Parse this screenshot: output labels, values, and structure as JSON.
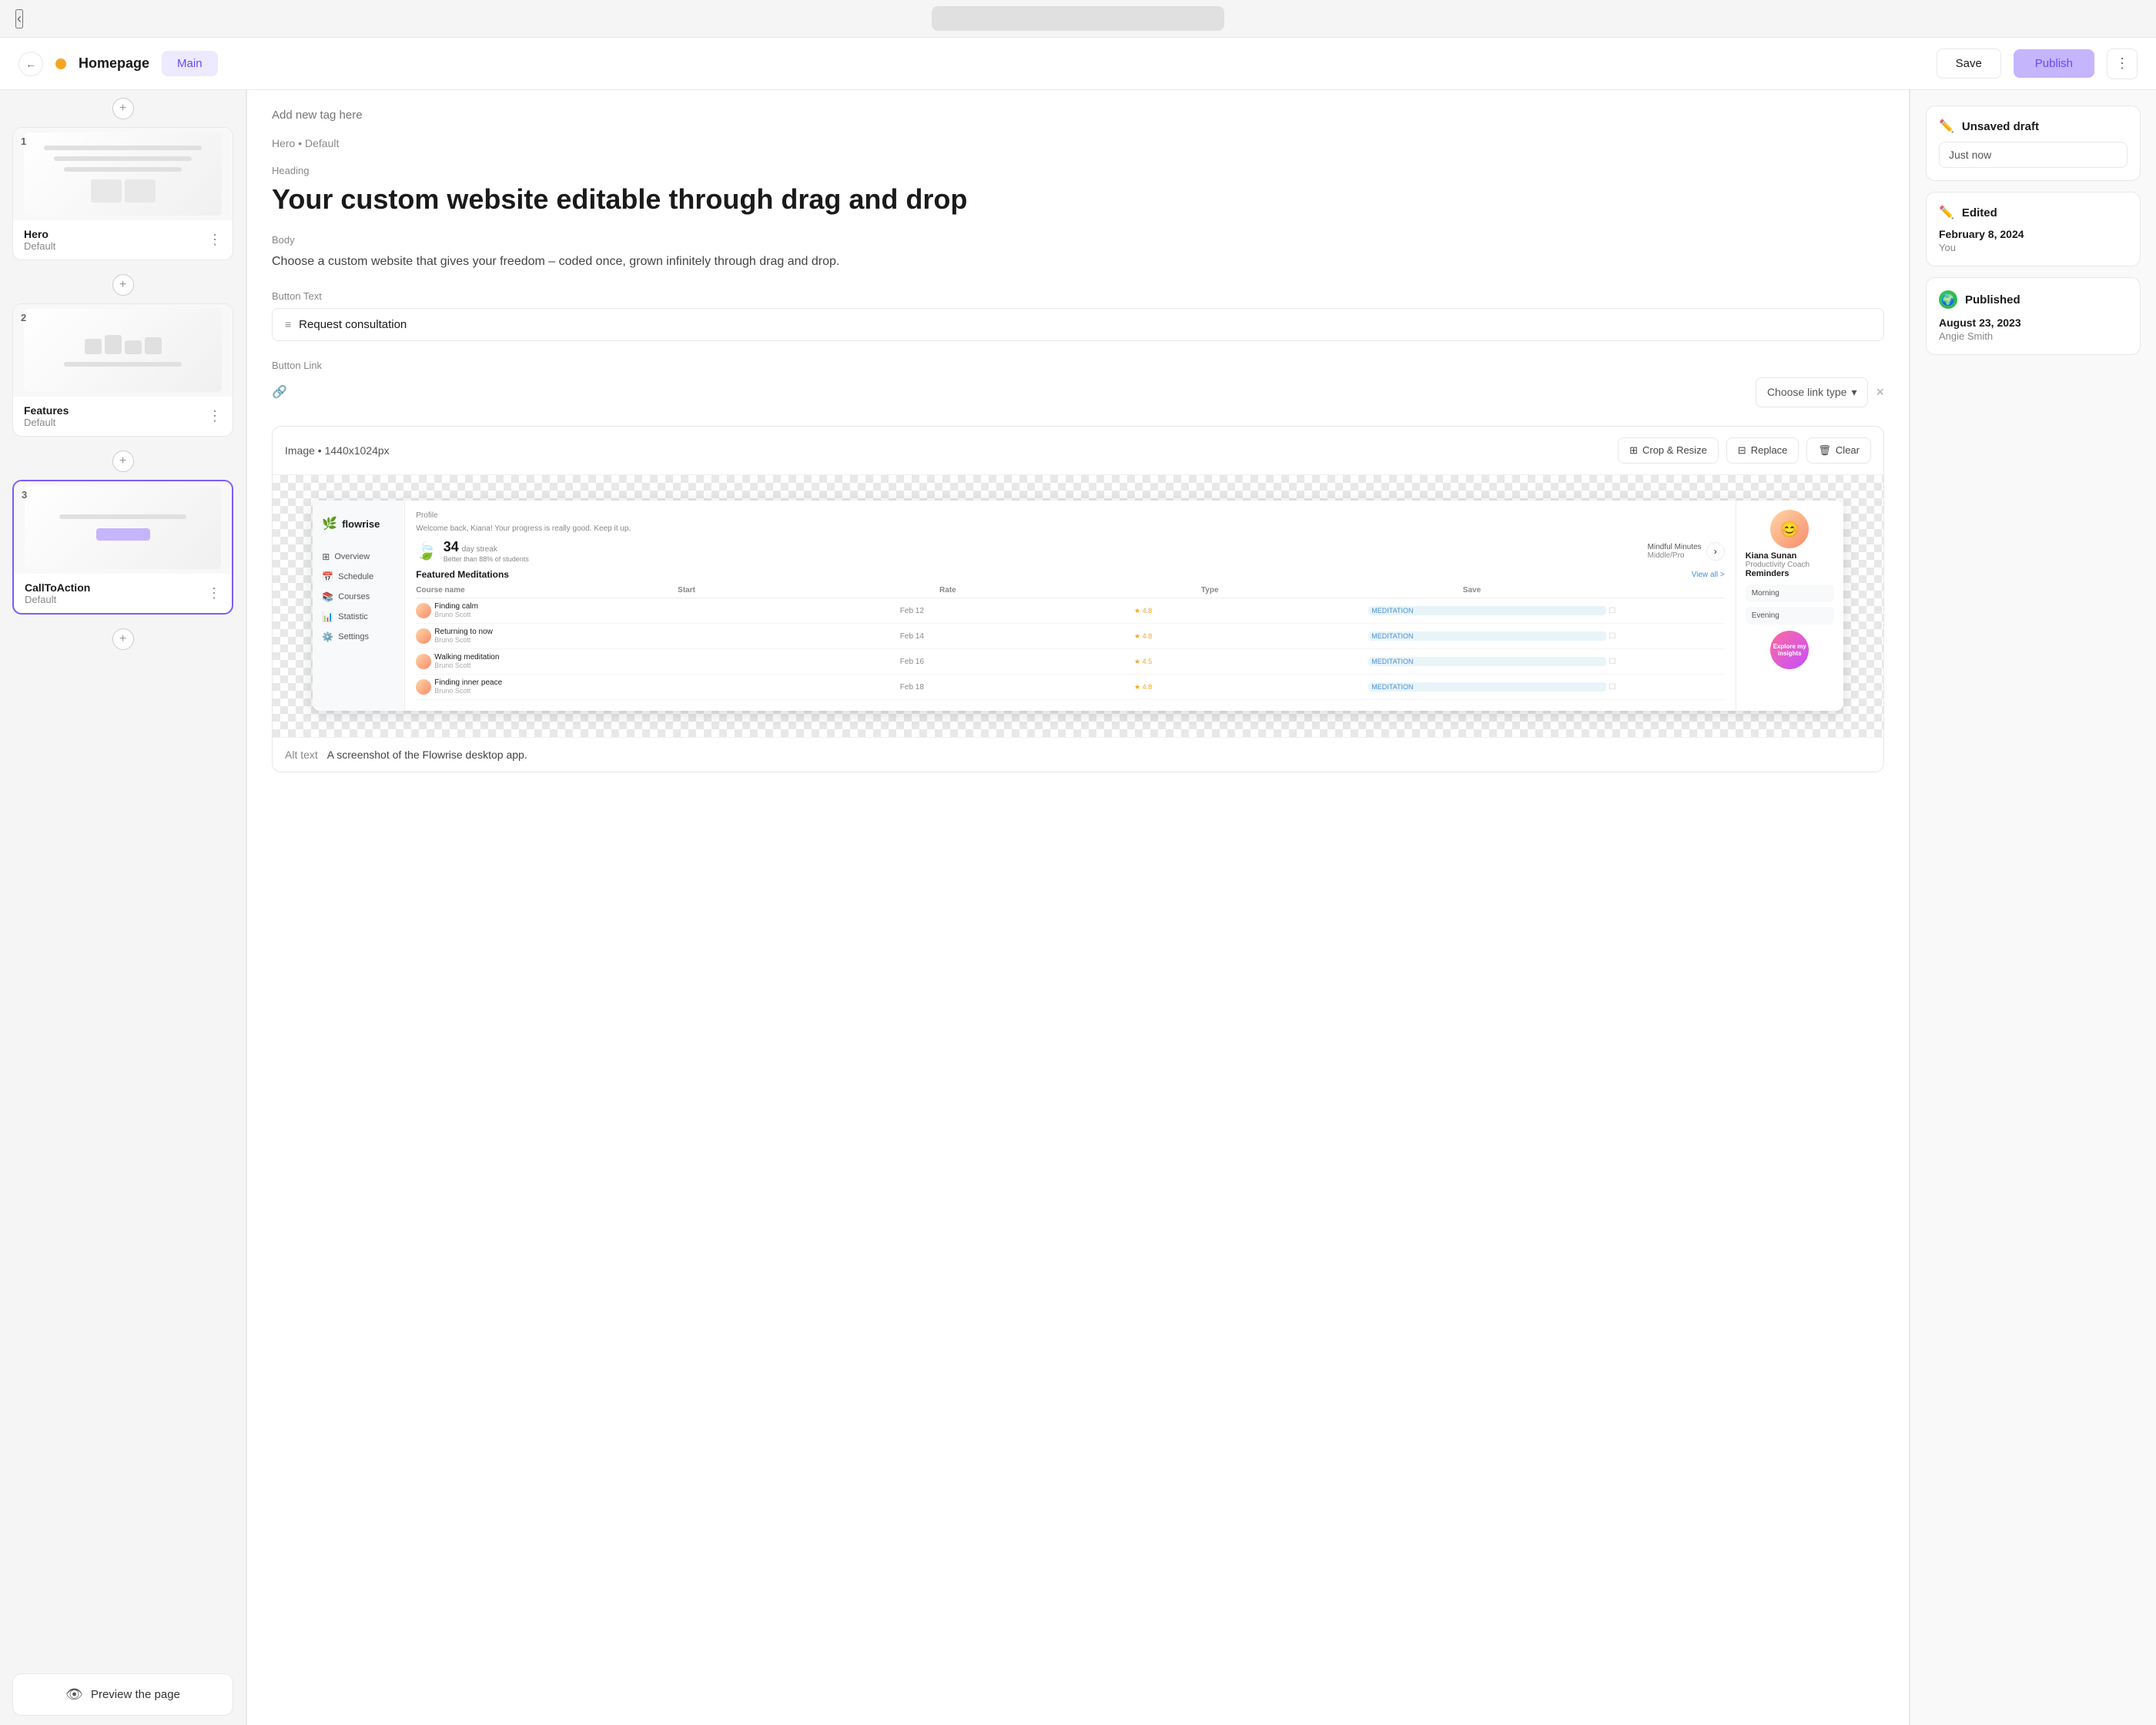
{
  "topBar": {
    "backLabel": "‹"
  },
  "header": {
    "backLabel": "←",
    "pageTitle": "Homepage",
    "pageIndicatorColor": "#f5a623",
    "tabLabel": "Main",
    "saveLabel": "Save",
    "publishLabel": "Publish",
    "moreLabel": "⋮"
  },
  "sidebar": {
    "addSectionLabel": "+",
    "sections": [
      {
        "id": 1,
        "name": "Hero",
        "variant": "Default"
      },
      {
        "id": 2,
        "name": "Features",
        "variant": "Default"
      },
      {
        "id": 3,
        "name": "CallToAction",
        "variant": "Default",
        "active": true
      }
    ],
    "previewLabel": "Preview the page"
  },
  "editor": {
    "tagPlaceholder": "Add new tag here",
    "breadcrumb": "Hero • Default",
    "heading": {
      "label": "Heading",
      "value": "Your custom website editable through drag and drop"
    },
    "body": {
      "label": "Body",
      "value": "Choose a custom website that gives your freedom – coded once, grown infinitely through drag and drop."
    },
    "buttonText": {
      "label": "Button Text",
      "value": "Request consultation"
    },
    "buttonLink": {
      "label": "Button Link",
      "placeholder": "Choose link type",
      "clearLabel": "×"
    },
    "image": {
      "label": "Image",
      "dimensions": "1440x1024px",
      "cropLabel": "Crop & Resize",
      "replaceLabel": "Replace",
      "clearLabel": "Clear",
      "altTextLabel": "Alt text",
      "altTextValue": "A screenshot of the Flowrise desktop app."
    },
    "appScreenshot": {
      "logoText": "flowrise",
      "profileTitle": "Profile",
      "welcomeText": "Welcome back, Kiana! Your progress is really good. Keep it up.",
      "streakNum": "34",
      "streakLabel": "day streak",
      "streakSub": "Better than 88% of students",
      "profileName": "Kiana Sunan",
      "profileRole": "Productivity Coach",
      "sectionTitle": "Featured Meditations",
      "viewAllLabel": "View all >",
      "tableHeaders": [
        "Course name",
        "Start",
        "Rate",
        "Type",
        "Save"
      ],
      "rows": [
        {
          "name": "Finding calm",
          "author": "Bruno Scott",
          "date": "Feb 12",
          "stars": "★ 4.8",
          "badge": "MEDITATION"
        },
        {
          "name": "Returning to now",
          "author": "Bruno Scott",
          "date": "Feb 14",
          "stars": "★ 4.8",
          "badge": "MEDITATION"
        },
        {
          "name": "Walking meditation",
          "author": "Bruno Scott",
          "date": "Feb 16",
          "stars": "★ 4.5",
          "badge": "MEDITATION"
        },
        {
          "name": "Finding inner peace",
          "author": "Bruno Scott",
          "date": "Feb 18",
          "stars": "★ 4.8",
          "badge": "MEDITATION"
        }
      ],
      "navItems": [
        "Overview",
        "Schedule",
        "Courses",
        "Statistic",
        "Settings"
      ],
      "remindersTitle": "Reminders",
      "exploreLabel": "Explore my insights",
      "mindfulLabel": "Mindful Minutes",
      "mindfulSub": "Middle/Pro"
    }
  },
  "rightPanel": {
    "unsavedDraft": {
      "typeLabel": "Unsaved draft",
      "timeLabel": "Just now"
    },
    "edited": {
      "typeLabel": "Edited",
      "dateLabel": "February 8, 2024",
      "authorLabel": "You"
    },
    "published": {
      "typeLabel": "Published",
      "dateLabel": "August 23, 2023",
      "authorLabel": "Angie Smith"
    }
  },
  "icons": {
    "back": "←",
    "plus": "+",
    "eye": "👁",
    "pencil": "✏️",
    "globe": "🌍",
    "hamburger": "≡",
    "link": "🔗",
    "crop": "⊞",
    "replace": "⊟",
    "trash": "🗑",
    "chevronDown": "▾",
    "drag": "⠿",
    "more": "⋮"
  }
}
